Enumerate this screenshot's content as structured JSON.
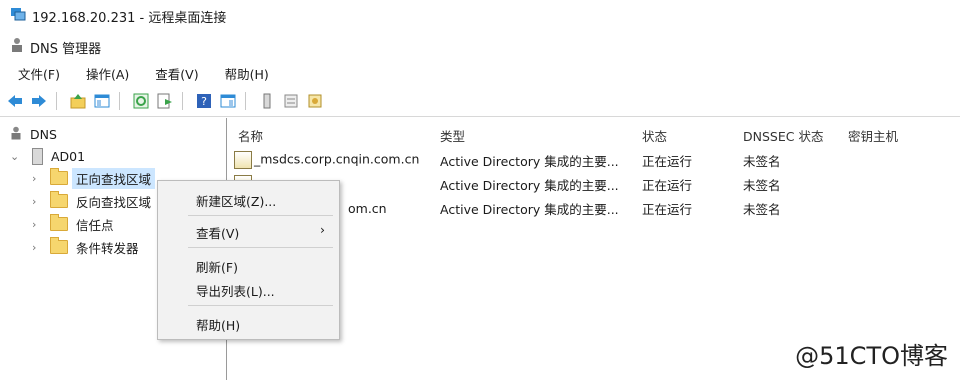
{
  "rdp": {
    "title": "192.168.20.231 - 远程桌面连接"
  },
  "app": {
    "title": "DNS 管理器"
  },
  "menu": [
    "文件(F)",
    "操作(A)",
    "查看(V)",
    "帮助(H)"
  ],
  "tree": {
    "root": "DNS",
    "server": "AD01",
    "items": [
      "正向查找区域",
      "反向查找区域",
      "信任点",
      "条件转发器"
    ]
  },
  "list": {
    "headers": [
      "名称",
      "类型",
      "状态",
      "DNSSEC 状态",
      "密钥主机"
    ],
    "rows": [
      {
        "name": "_msdcs.corp.cnqin.com.cn",
        "type": "Active Directory 集成的主要...",
        "status": "正在运行",
        "dnssec": "未签名"
      },
      {
        "name": "",
        "type": "Active Directory 集成的主要...",
        "status": "正在运行",
        "dnssec": "未签名"
      },
      {
        "name": "om.cn",
        "type": "Active Directory 集成的主要...",
        "status": "正在运行",
        "dnssec": "未签名"
      }
    ]
  },
  "context_menu": {
    "new_zone": "新建区域(Z)...",
    "view": "查看(V)",
    "refresh": "刷新(F)",
    "export": "导出列表(L)...",
    "help": "帮助(H)"
  },
  "watermark": "@51CTO博客",
  "icons": {
    "rdp": "remote-desktop-icon",
    "dns": "dns-icon",
    "back": "back-arrow-icon",
    "forward": "forward-arrow-icon",
    "accent_blue": "#2e8bd6",
    "accent_green": "#3aa34a"
  }
}
